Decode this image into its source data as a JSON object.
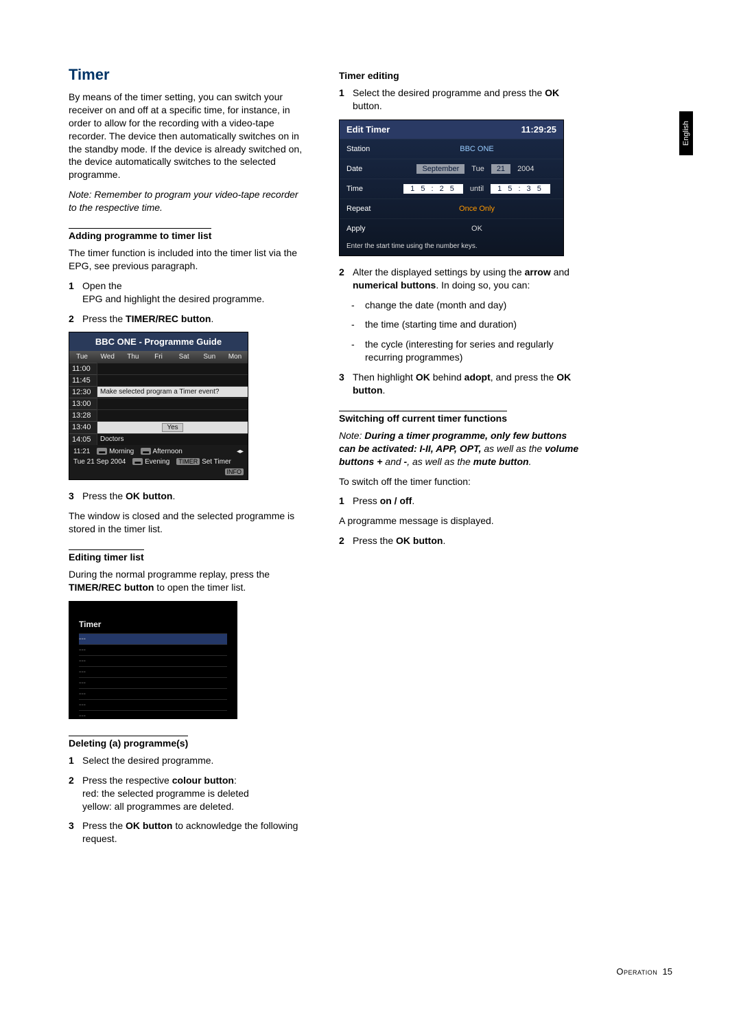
{
  "sideTab": "English",
  "title": "Timer",
  "intro": "By means of the timer setting, you can switch your receiver on and off at a specific time, for instance, in order to allow for the recording with a video-tape recorder. The device then automatically switches on in the standby mode. If the device is already switched on, the device automatically switches to the selected programme.",
  "introNote": "Note:  Remember to program your video-tape recorder to the respective time.",
  "sub1": "Adding programme to timer list",
  "sub1_p": "The timer function is included into the timer list via the EPG, see previous paragraph.",
  "sub1_1": "Open the\nEPG and highlight the desired programme.",
  "sub1_2a": "Press the ",
  "sub1_2b": "TIMER/REC button",
  "sub1_2c": ".",
  "epg": {
    "title": "BBC ONE - Programme Guide",
    "days": [
      "Tue",
      "Wed",
      "Thu",
      "Fri",
      "Sat",
      "Sun",
      "Mon"
    ],
    "times": [
      "11:00",
      "11:45",
      "12:30",
      "13:00",
      "13:28",
      "13:40",
      "14:05"
    ],
    "promptText": "Make selected program a Timer event?",
    "promptYes": "Yes",
    "cell14": "Doctors",
    "footClock": "11:21",
    "footDate": "Tue 21 Sep 2004",
    "legend": [
      "Morning",
      "Afternoon",
      "Evening",
      "Set Timer"
    ],
    "timerTag": "TIMER",
    "infoTag": "INFO"
  },
  "sub1_3a": "Press the ",
  "sub1_3b": "OK button",
  "sub1_3c": ".",
  "sub1_after": "The window is closed and the selected programme is stored in the timer list.",
  "sub2": "Editing timer list",
  "sub2_p1a": "During the normal programme replay, press the ",
  "sub2_p1b": "TIMER/REC button",
  "sub2_p1c": " to open the timer list.",
  "timerShot": {
    "title": "Timer",
    "dots": "---"
  },
  "sub3": "Deleting (a) programme(s)",
  "sub3_1": "Select the desired programme.",
  "sub3_2a": "Press the respective ",
  "sub3_2b": "colour button",
  "sub3_2c": ":\nred: the selected programme is deleted\nyellow: all programmes are deleted.",
  "sub3_3a": "Press the ",
  "sub3_3b": "OK button",
  "sub3_3c": " to acknowledge the following request.",
  "subR1": "Timer editing",
  "r1_1a": "Select the desired programme and press the ",
  "r1_1b": "OK",
  "r1_1c": " button.",
  "edit": {
    "title": "Edit Timer",
    "clock": "11:29:25",
    "rows": {
      "station_l": "Station",
      "station_v": "BBC ONE",
      "date_l": "Date",
      "date_month": "September",
      "date_day": "Tue",
      "date_num": "21",
      "date_year": "2004",
      "time_l": "Time",
      "time_start": "1 5 : 2 5",
      "time_word": "until",
      "time_end": "1 5 : 3 5",
      "repeat_l": "Repeat",
      "repeat_v": "Once Only",
      "apply_l": "Apply",
      "apply_v": "OK"
    },
    "footmsg": "Enter the start time using the number keys."
  },
  "r1_2a": "Alter the displayed settings by using the ",
  "r1_2b": "arrow",
  "r1_2c": " and ",
  "r1_2d": "numerical buttons",
  "r1_2e": ". In doing so, you can:",
  "r1_bul1": "change the date (month and day)",
  "r1_bul2": "the time (starting time and duration)",
  "r1_bul3": "the cycle (interesting for series and regularly recurring programmes)",
  "r1_3a": "Then highlight ",
  "r1_3b": "OK",
  "r1_3c": " behind ",
  "r1_3d": "adopt",
  "r1_3e": ", and press the ",
  "r1_3f": "OK button",
  "r1_3g": ".",
  "subR2": "Switching off current timer functions",
  "r2_note_a": "Note:  ",
  "r2_note_b": "During a ",
  "r2_note_c": "timer programme, only few buttons can be activated: I-II, APP, OPT,",
  "r2_note_d": " as well as the ",
  "r2_note_e": "volume buttons +",
  "r2_note_f": " and ",
  "r2_note_g": "-",
  "r2_note_h": ", as well as the ",
  "r2_note_i": "mute button",
  "r2_note_j": ".",
  "r2_p": "To switch off the timer function:",
  "r2_1a": "Press ",
  "r2_1b": "on / off",
  "r2_1c": ".",
  "r2_after": "A programme message is displayed.",
  "r2_2a": "Press the ",
  "r2_2b": "OK button",
  "r2_2c": ".",
  "footer_cap": "Operation",
  "footer_pg": "15"
}
